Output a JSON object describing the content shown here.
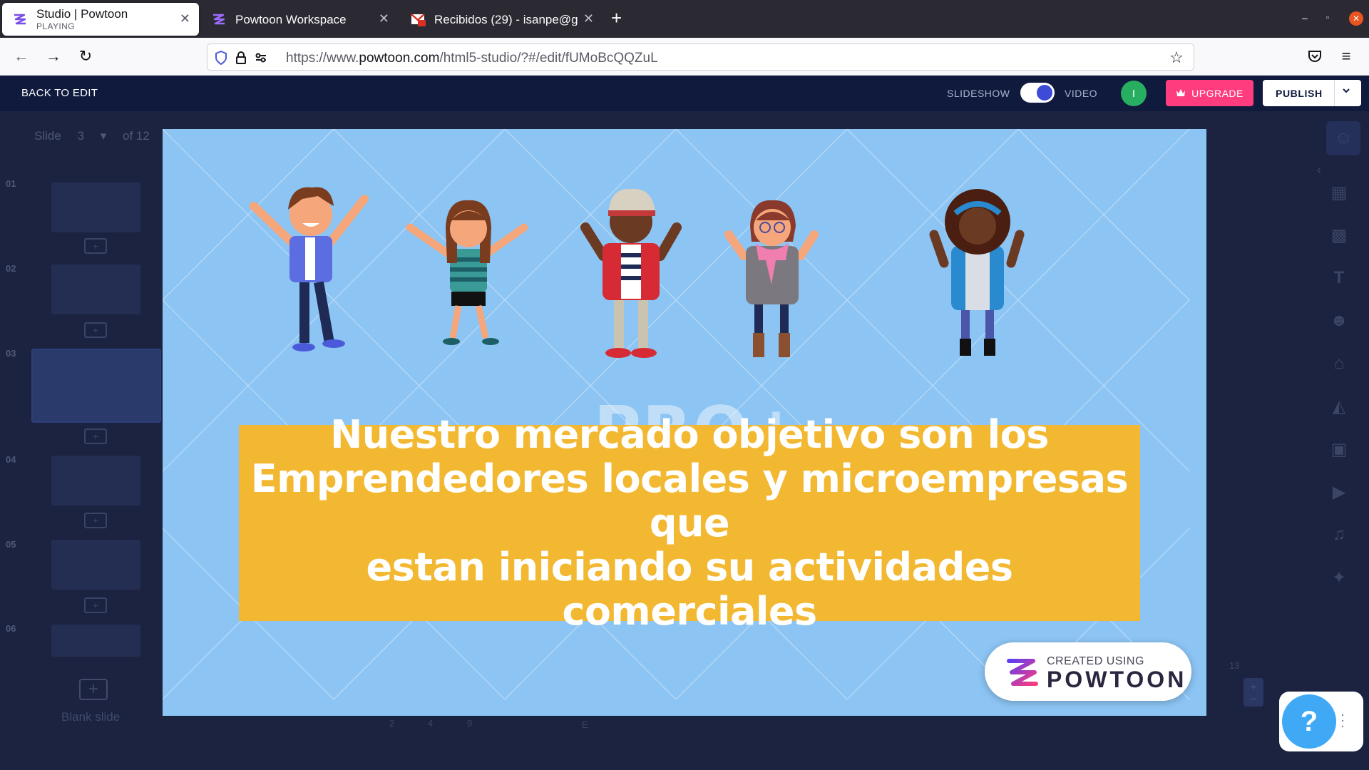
{
  "browser": {
    "tabs": [
      {
        "title": "Studio | Powtoon",
        "subtitle": "PLAYING",
        "active": true
      },
      {
        "title": "Powtoon Workspace",
        "active": false
      },
      {
        "title": "Recibidos (29) - isanpe@g",
        "active": false
      }
    ],
    "url_prefix": "https://www.",
    "url_domain": "powtoon.com",
    "url_path": "/html5-studio/?#/edit/fUMoBcQQZuL"
  },
  "topbar": {
    "back_label": "BACK TO EDIT",
    "slideshow_label": "SLIDESHOW",
    "video_label": "VIDEO",
    "toggle_state": "video",
    "avatar_initial": "I",
    "upgrade_label": "UPGRADE",
    "publish_label": "PUBLISH"
  },
  "sidebar": {
    "slide_label": "Slide",
    "current_slide": "3",
    "of_label": "of 12",
    "thumbnails": [
      {
        "num": "01"
      },
      {
        "num": "02"
      },
      {
        "num": "03"
      },
      {
        "num": "04"
      },
      {
        "num": "05"
      },
      {
        "num": "06"
      }
    ],
    "blank_slide_label": "Blank slide"
  },
  "slide": {
    "watermark": "PRO+",
    "banner_line1": "Nuestro mercado objetivo son los",
    "banner_line2": "Emprendedores locales y  microempresas que",
    "banner_line3": "estan iniciando su actividades  comerciales",
    "badge_small": "CREATED USING",
    "badge_big": "POWTOON"
  },
  "timeline": {
    "markers": [
      "2",
      "4",
      "9",
      "E"
    ],
    "zoom_label": "13"
  },
  "help": {
    "label": "?"
  },
  "colors": {
    "chrome_bg": "#2b2a33",
    "powtoon_bar": "#0f1a3d",
    "stage_bg": "#8cc4f3",
    "banner": "#f3b831",
    "upgrade": "#ff3c7d",
    "help": "#3fa9f5"
  }
}
